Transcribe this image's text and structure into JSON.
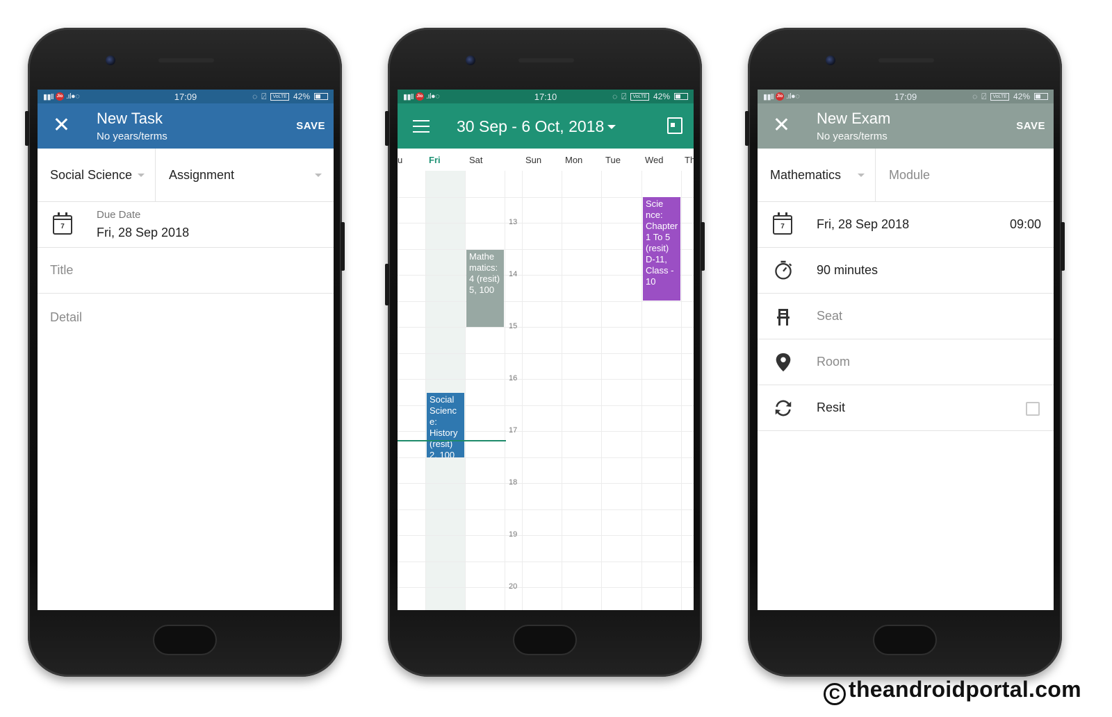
{
  "colors": {
    "task_header": "#2f6fa8",
    "calendar_header": "#1f9275",
    "exam_header": "#8e9f99",
    "event_math": "#98a8a3",
    "event_science": "#9b4fc4",
    "event_social": "#2f78b0"
  },
  "phone1": {
    "status": {
      "time": "17:09",
      "battery": "42%"
    },
    "toolbar": {
      "title": "New Task",
      "subtitle": "No years/terms",
      "save": "SAVE",
      "close_icon": "close-icon"
    },
    "subject": "Social Science",
    "type": "Assignment",
    "due_label": "Due Date",
    "due_value": "Fri, 28 Sep 2018",
    "calendar_icon_day": "7",
    "title_placeholder": "Title",
    "detail_placeholder": "Detail"
  },
  "phone2": {
    "status": {
      "time": "17:10",
      "battery": "42%"
    },
    "toolbar": {
      "range": "30 Sep - 6 Oct, 2018"
    },
    "days": [
      "u",
      "Fri",
      "Sat",
      "Sun",
      "Mon",
      "Tue",
      "Wed",
      "Th"
    ],
    "hours": [
      "13",
      "14",
      "15",
      "16",
      "17",
      "18",
      "19",
      "20"
    ],
    "events": [
      {
        "text": "Mathe matics: 4 (resit) 5, 100",
        "color": "#98a8a3"
      },
      {
        "text": "Scie nce: Chapter 1 To 5 (resit) D-11, Class - 10",
        "color": "#9b4fc4"
      },
      {
        "text": "Social Scienc e: History (resit) 2, 100",
        "color": "#2f78b0"
      }
    ]
  },
  "phone3": {
    "status": {
      "time": "17:09",
      "battery": "42%"
    },
    "toolbar": {
      "title": "New Exam",
      "subtitle": "No years/terms",
      "save": "SAVE"
    },
    "subject": "Mathematics",
    "module_placeholder": "Module",
    "date": "Fri, 28 Sep 2018",
    "time": "09:00",
    "duration": "90 minutes",
    "seat_placeholder": "Seat",
    "room_placeholder": "Room",
    "resit_label": "Resit",
    "resit_checked": false
  },
  "watermark": "theandroidportal.com",
  "watermark_symbol": "C"
}
